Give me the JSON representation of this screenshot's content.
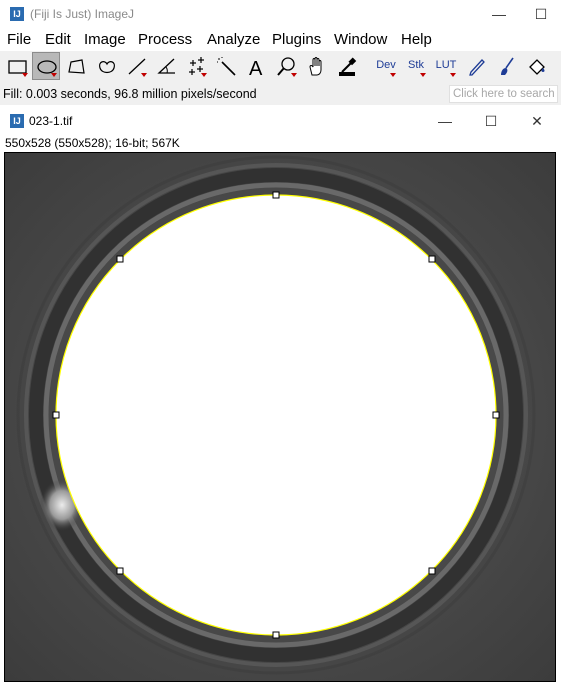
{
  "main_window": {
    "title": "(Fiji Is Just) ImageJ",
    "icon": "fiji-app-icon",
    "controls": {
      "minimize": "—",
      "maximize": "☐"
    }
  },
  "menu": {
    "items": [
      "File",
      "Edit",
      "Image",
      "Process",
      "Analyze",
      "Plugins",
      "Window",
      "Help"
    ]
  },
  "toolbar": {
    "tools": [
      {
        "name": "rectangle-tool",
        "icon": "rectangle-icon",
        "has_menu": true,
        "selected": false
      },
      {
        "name": "oval-tool",
        "icon": "oval-icon",
        "has_menu": true,
        "selected": true
      },
      {
        "name": "polygon-tool",
        "icon": "polygon-icon",
        "has_menu": false,
        "selected": false
      },
      {
        "name": "freehand-tool",
        "icon": "freehand-icon",
        "has_menu": false,
        "selected": false
      },
      {
        "name": "line-tool",
        "icon": "line-icon",
        "has_menu": true,
        "selected": false
      },
      {
        "name": "angle-tool",
        "icon": "angle-icon",
        "has_menu": false,
        "selected": false
      },
      {
        "name": "point-tool",
        "icon": "multipoint-icon",
        "has_menu": true,
        "selected": false
      },
      {
        "name": "wand-tool",
        "icon": "wand-icon",
        "has_menu": false,
        "selected": false
      },
      {
        "name": "text-tool",
        "icon": "text-icon",
        "has_menu": false,
        "selected": false
      },
      {
        "name": "zoom-tool",
        "icon": "magnifier-icon",
        "has_menu": true,
        "selected": false
      },
      {
        "name": "hand-tool",
        "icon": "hand-icon",
        "has_menu": false,
        "selected": false
      },
      {
        "name": "dropper-tool",
        "icon": "dropper-icon",
        "has_menu": false,
        "selected": false
      },
      {
        "name": "dev-tool",
        "label": "Dev",
        "has_menu": true
      },
      {
        "name": "stk-tool",
        "label": "Stk",
        "has_menu": true
      },
      {
        "name": "lut-tool",
        "label": "LUT",
        "has_menu": true
      },
      {
        "name": "pencil-tool",
        "icon": "pencil-icon",
        "has_menu": false
      },
      {
        "name": "brush-tool",
        "icon": "brush-icon",
        "has_menu": false
      },
      {
        "name": "flood-fill-tool",
        "icon": "bucket-icon",
        "has_menu": false
      }
    ]
  },
  "status": {
    "message": "Fill: 0.003 seconds, 96.8 million pixels/second",
    "search_placeholder": "Click here to search"
  },
  "image_window": {
    "title": "023-1.tif",
    "info": "550x528   (550x528); 16-bit; 567K",
    "controls": {
      "minimize": "—",
      "maximize": "☐",
      "close": "✕"
    },
    "roi_color": "#ffff00",
    "background_gray": "#4a4a4a"
  }
}
